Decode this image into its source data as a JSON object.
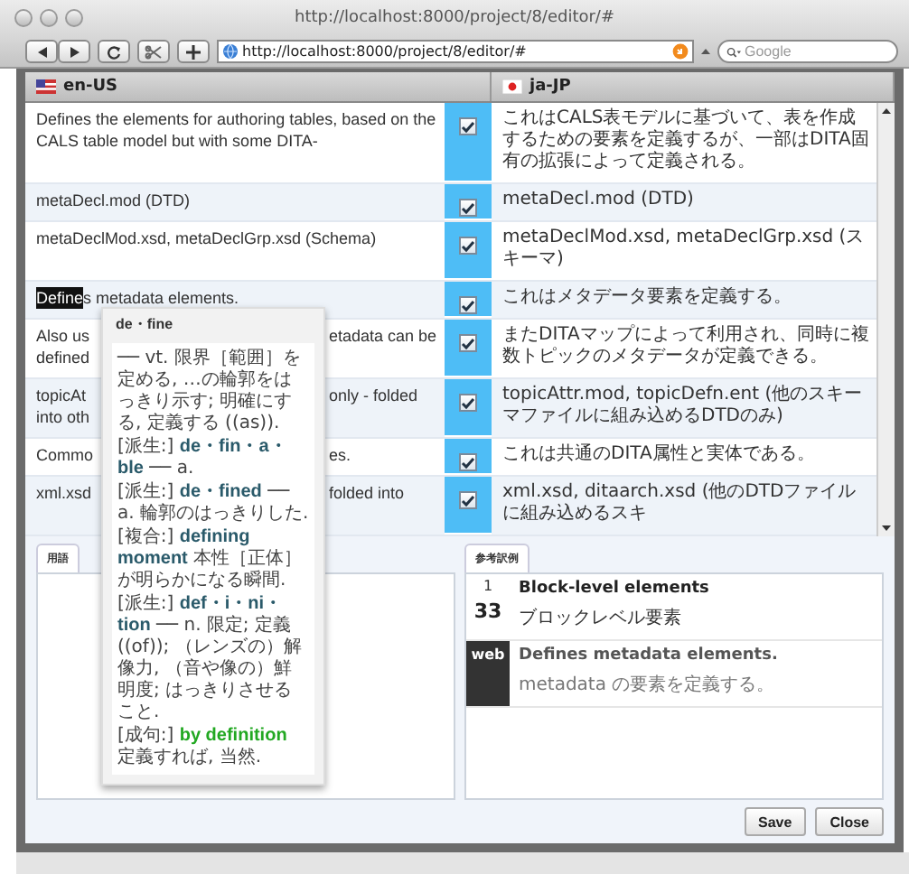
{
  "window": {
    "title": "http://localhost:8000/project/8/editor/#"
  },
  "toolbar": {
    "url": "http://localhost:8000/project/8/editor/#",
    "search": {
      "placeholder": "Google"
    }
  },
  "columns": [
    {
      "label": "en-US",
      "kind": "us"
    },
    {
      "label": "ja-JP",
      "kind": "jp"
    }
  ],
  "rows": [
    {
      "checked": true,
      "en": [
        {
          "kind": "plain",
          "text": "Defines the elements for authoring tables, based on the CALS table model but with some DITA-"
        }
      ],
      "ja": "これはCALS表モデルに基づいて、表を作成するための要素を定義するが、一部はDITA固有の拡張によって定義される。"
    },
    {
      "checked": true,
      "en": [
        {
          "kind": "plain",
          "text": "metaDecl.mod (DTD)"
        }
      ],
      "ja": "metaDecl.mod (DTD)"
    },
    {
      "checked": true,
      "en": [
        {
          "kind": "plain",
          "text": "metaDeclMod.xsd, metaDeclGrp.xsd (Schema)"
        }
      ],
      "ja": "metaDeclMod.xsd, metaDeclGrp.xsd (スキーマ)"
    },
    {
      "checked": true,
      "en": [
        {
          "kind": "selection",
          "selected": "Define",
          "rest": "s metadata elements."
        }
      ],
      "ja": "これはメタデータ要素を定義する。"
    },
    {
      "checked": true,
      "en": [
        {
          "kind": "split",
          "before": "Also us",
          "after": "etadata can be"
        },
        {
          "kind": "split",
          "before": "defined"
        }
      ],
      "ja": "またDITAマップによって利用され、同時に複数トピックのメタデータが定義できる。"
    },
    {
      "checked": true,
      "en": [
        {
          "kind": "split",
          "before": "topicAt",
          "after": "only - folded"
        },
        {
          "kind": "split",
          "before": "into oth"
        }
      ],
      "ja": "topicAttr.mod, topicDefn.ent (他のスキーマファイルに組み込めるDTDのみ)"
    },
    {
      "checked": true,
      "en": [
        {
          "kind": "split",
          "before": "Commo",
          "after": "es."
        }
      ],
      "ja": "これは共通のDITA属性と実体である。"
    },
    {
      "checked": true,
      "en": [
        {
          "kind": "split",
          "before": "xml.xsd",
          "after": "folded into"
        }
      ],
      "ja": "xml.xsd, ditaarch.xsd (他のDTDファイルに組み込めるスキ"
    }
  ],
  "dictionary_popup": {
    "headword": "de・fine",
    "entries": [
      {
        "text": "── vt. 限界［範囲］を定める, …の輪郭をはっきり示す; 明確にする, 定義する ((as))."
      },
      {
        "label": "[派生:]",
        "term": "de・fin・a・ble",
        "text": "── a.",
        "color": "#2a5a6a"
      },
      {
        "label": "[派生:]",
        "term": "de・fined",
        "text": "── a. 輪郭のはっきりした.",
        "color": "#2a5a6a"
      },
      {
        "label": "[複合:]",
        "term": "defining moment",
        "text": "本性［正体］が明らかになる瞬間.",
        "color": "#2a5a6a"
      },
      {
        "label": "[派生:]",
        "term": "def・i・ni・tion",
        "text": "── n. 限定; 定義 ((of)); （レンズの）解像力, （音や像の）鮮明度; はっきりさせること.",
        "color": "#2a5a6a"
      },
      {
        "label": "[成句:]",
        "term": "by definition",
        "text": "定義すれば, 当然.",
        "color": "#22a822"
      }
    ]
  },
  "glossary_panel": {
    "tab": "用語"
  },
  "reference_panel": {
    "tab": "参考訳例",
    "entries": [
      {
        "kind": "match",
        "rank": "1",
        "score": "33",
        "source": "Block-level elements",
        "target": "ブロックレベル要素"
      },
      {
        "kind": "web",
        "badge": "web",
        "source": "Defines metadata elements.",
        "target": "metadata の要素を定義する。"
      }
    ]
  },
  "buttons": [
    "Save",
    "Close"
  ]
}
